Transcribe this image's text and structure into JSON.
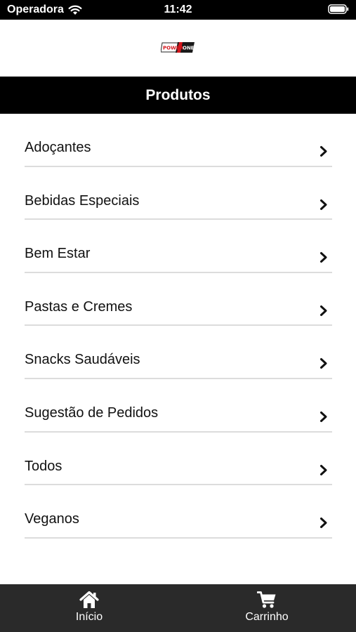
{
  "status_bar": {
    "carrier": "Operadora",
    "time": "11:42"
  },
  "header": {
    "logo": "POWER ONE",
    "title": "Produtos"
  },
  "categories": [
    {
      "label": "Adoçantes"
    },
    {
      "label": "Bebidas Especiais"
    },
    {
      "label": "Bem Estar"
    },
    {
      "label": "Pastas e Cremes"
    },
    {
      "label": "Snacks Saudáveis"
    },
    {
      "label": "Sugestão de Pedidos"
    },
    {
      "label": "Todos"
    },
    {
      "label": "Veganos"
    }
  ],
  "tab_bar": {
    "tabs": [
      {
        "label": "Início",
        "icon": "home-icon"
      },
      {
        "label": "Carrinho",
        "icon": "cart-icon"
      }
    ]
  }
}
